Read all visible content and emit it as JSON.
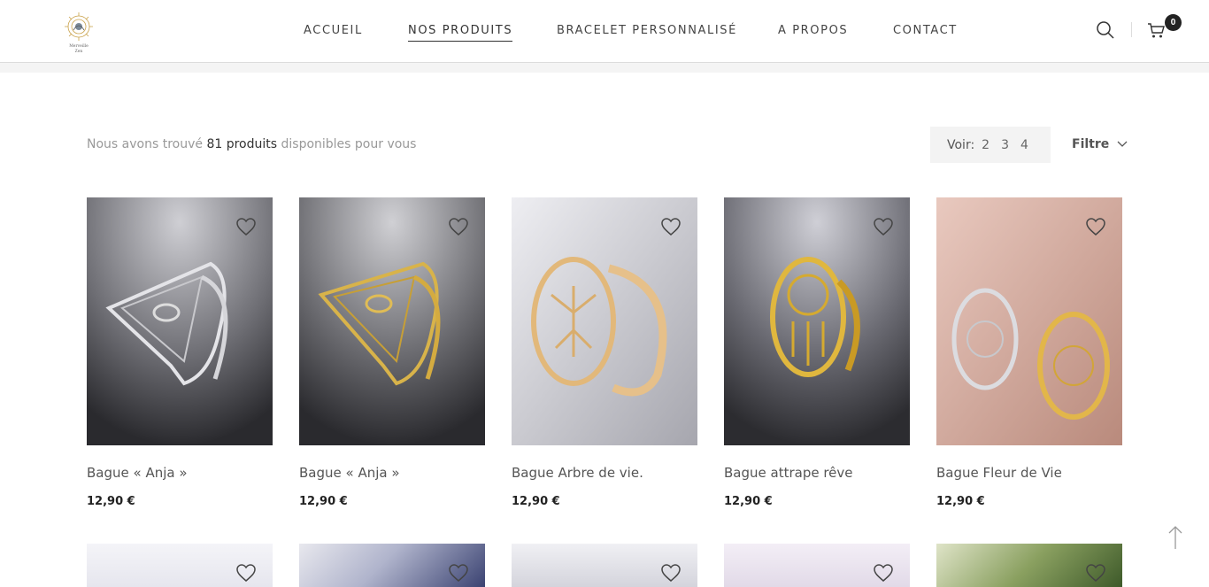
{
  "header": {
    "logo_icon": "brand-logo-icon",
    "nav": [
      {
        "label": "ACCUEIL",
        "active": false
      },
      {
        "label": "NOS PRODUITS",
        "active": true
      },
      {
        "label": "BRACELET PERSONNALISÉ",
        "active": false
      },
      {
        "label": "A PROPOS",
        "active": false
      },
      {
        "label": "CONTACT",
        "active": false
      }
    ],
    "cart_count": "0"
  },
  "toolbar": {
    "found_prefix": "Nous avons trouvé",
    "found_count": "81 produits",
    "found_suffix": "disponibles pour vous",
    "voir_label": "Voir:",
    "voir_options": [
      "2",
      "3",
      "4"
    ],
    "filter_label": "Filtre"
  },
  "products": [
    {
      "name": "Bague « Anja »",
      "price": "12,90 €"
    },
    {
      "name": "Bague « Anja »",
      "price": "12,90 €"
    },
    {
      "name": "Bague Arbre de vie.",
      "price": "12,90 €"
    },
    {
      "name": "Bague attrape rêve",
      "price": "12,90 €"
    },
    {
      "name": "Bague Fleur de Vie",
      "price": "12,90 €"
    }
  ],
  "colors": {
    "accent": "#222222",
    "muted_text": "#999999",
    "toolbar_bg": "#f3f3f3"
  }
}
